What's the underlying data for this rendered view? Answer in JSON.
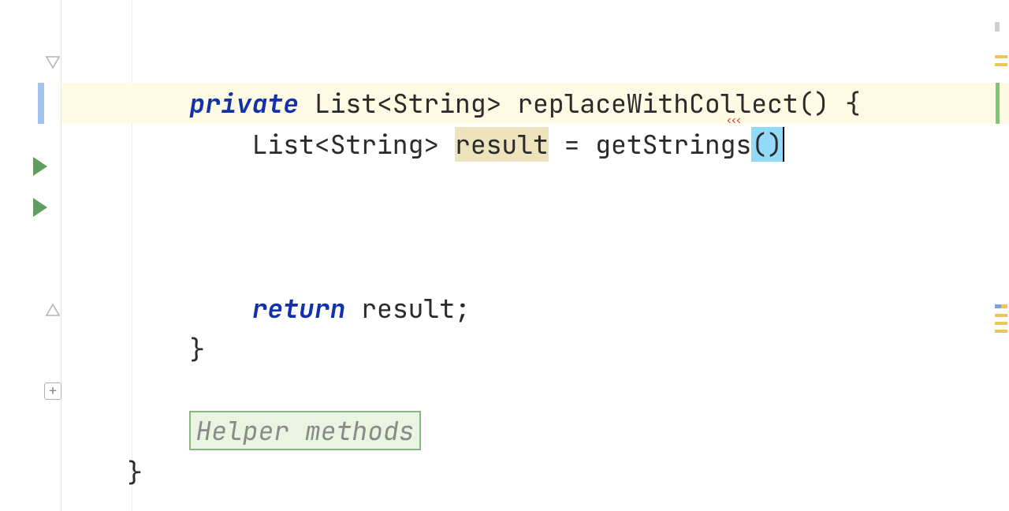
{
  "code": {
    "line1": {
      "indent": "    ",
      "kw": "private",
      "rest": " List<String> replaceWithCollect() {"
    },
    "line2": {
      "indent": "        ",
      "type_part": "List<String> ",
      "result_var": "result",
      "eq": " = ",
      "call": "getStrings",
      "parens": "()"
    },
    "line_return": {
      "indent": "        ",
      "kw": "return",
      "rest": " result;"
    },
    "close_brace_method": {
      "indent": "    ",
      "text": "}"
    },
    "fold_label": "Helper methods",
    "close_brace_class": {
      "indent": "",
      "text": "}"
    }
  },
  "icons": {
    "fold_handle": "fold-collapse-icon",
    "run": "run-icon",
    "expand": "expand-plus-icon"
  }
}
